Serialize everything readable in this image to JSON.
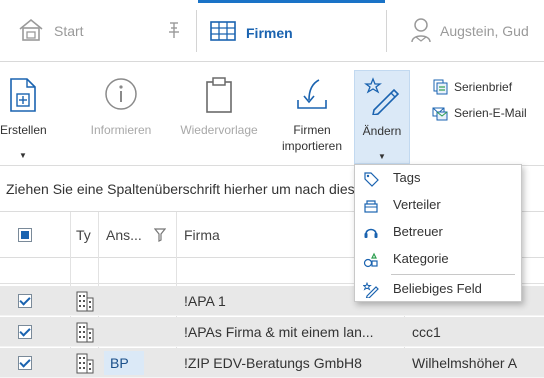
{
  "tabs": {
    "start": {
      "label": "Start",
      "icon": "home-icon"
    },
    "pin": {
      "icon": "pin-icon"
    },
    "firmen": {
      "label": "Firmen",
      "icon": "grid-table-icon",
      "accent": "#1a73c7"
    },
    "person": {
      "label": "Augstein, Gud",
      "icon": "person-icon"
    }
  },
  "ribbon": {
    "erstellen": {
      "label": "Erstellen",
      "icon": "new-document-icon"
    },
    "informieren": {
      "label": "Informieren",
      "icon": "info-icon",
      "disabled": true
    },
    "wiedervorlage": {
      "label": "Wiedervorlage",
      "icon": "clipboard-icon",
      "disabled": true
    },
    "import": {
      "label_line1": "Firmen",
      "label_line2": "importieren",
      "icon": "import-icon"
    },
    "aendern": {
      "label": "Ändern",
      "icon": "star-pencil-icon"
    },
    "serienbrief": {
      "label": "Serienbrief",
      "icon": "letter-icon"
    },
    "serienmail": {
      "label": "Serien-E-Mail",
      "icon": "email-icon"
    }
  },
  "group_hint": "Ziehen Sie eine Spaltenüberschrift hierher um nach dieser Spalte zu gruppieren",
  "grid": {
    "headers": {
      "type": "Ty",
      "ansprech": "Ans...",
      "firma": "Firma"
    },
    "rows": [
      {
        "checked": true,
        "icon": "building-icon",
        "ansprech": "",
        "firma": "!APA 1",
        "extra": ""
      },
      {
        "checked": true,
        "icon": "building-icon",
        "ansprech": "",
        "firma": "!APAs Firma & mit einem lan...",
        "extra": "ccc1"
      },
      {
        "checked": true,
        "icon": "building-icon",
        "ansprech": "BP",
        "firma": "!ZIP EDV-Beratungs GmbH8",
        "extra": "Wilhelmshöher A"
      }
    ]
  },
  "menu": {
    "items": [
      {
        "label": "Tags",
        "icon": "tag-icon"
      },
      {
        "label": "Verteiler",
        "icon": "distribution-icon"
      },
      {
        "label": "Betreuer",
        "icon": "support-icon"
      },
      {
        "label": "Kategorie",
        "icon": "category-icon"
      },
      {
        "label": "Beliebiges Feld",
        "icon": "edit-field-icon"
      }
    ]
  }
}
